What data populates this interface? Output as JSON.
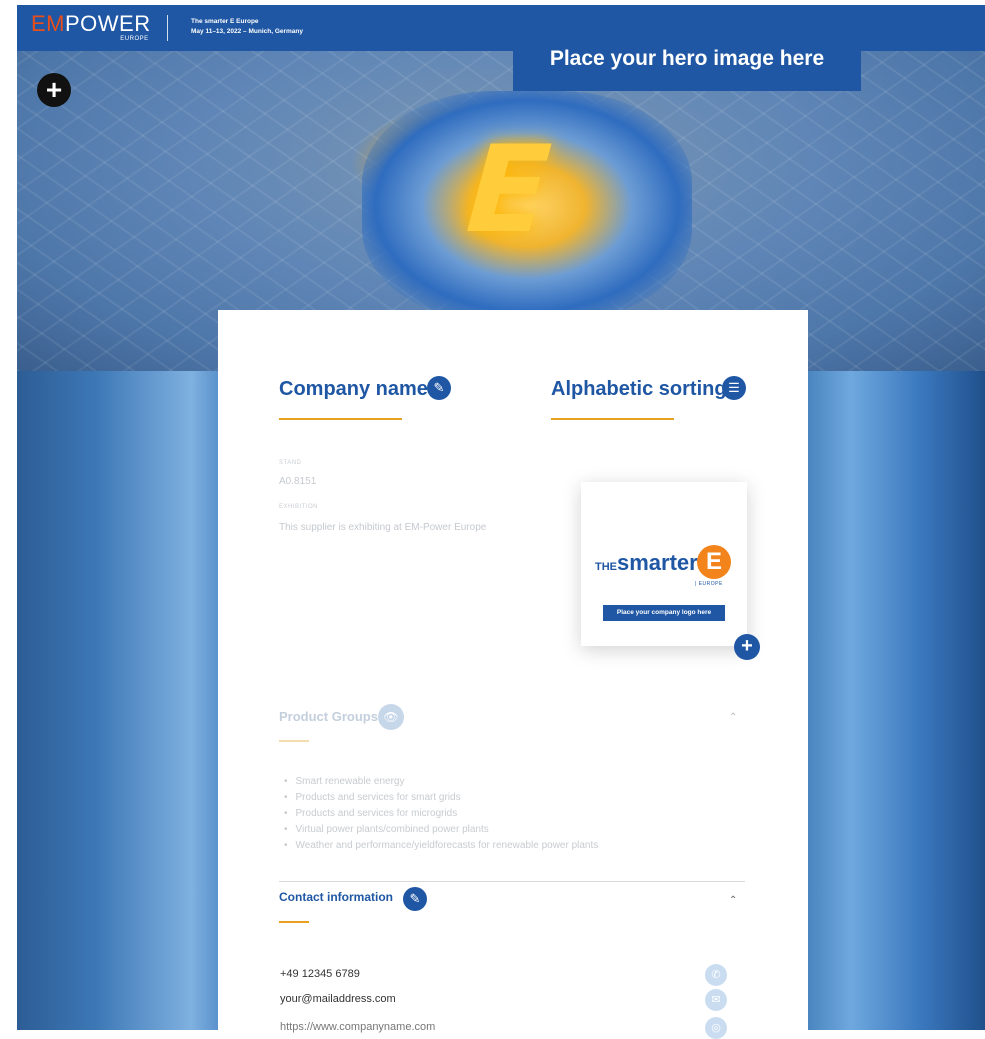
{
  "header": {
    "logo_em": "EM",
    "logo_power": "POWER",
    "logo_europe": "EUROPE",
    "event_line1": "The smarter E Europe",
    "event_line2": "May 11–13, 2022 – Munich, Germany"
  },
  "hero": {
    "label": "Place your hero image here"
  },
  "company": {
    "name": "Company name",
    "sorting": "Alphabetic sorting",
    "stand_label": "STAND",
    "stand_value": "A0.8151",
    "exhibition_label": "EXHIBITION",
    "exhibition_value": "This supplier is exhibiting at EM-Power Europe"
  },
  "logo_card": {
    "the": "THE",
    "smarter": "smarter",
    "e": "E",
    "europe": "| EUROPE",
    "caption": "Place your company logo here"
  },
  "product_groups": {
    "title": "Product Groups",
    "items": [
      "Smart renewable energy",
      "Products and services for smart grids",
      "Products and services for microgrids",
      "Virtual power plants/combined power plants",
      "Weather and performance/yieldforecasts for renewable power plants"
    ]
  },
  "contact": {
    "title": "Contact information",
    "phone": "+49 12345 6789",
    "email": "your@mailaddress.com",
    "website": "https://www.companyname.com"
  },
  "colors": {
    "brand_blue": "#1f57a4",
    "accent_orange": "#e8a020"
  }
}
